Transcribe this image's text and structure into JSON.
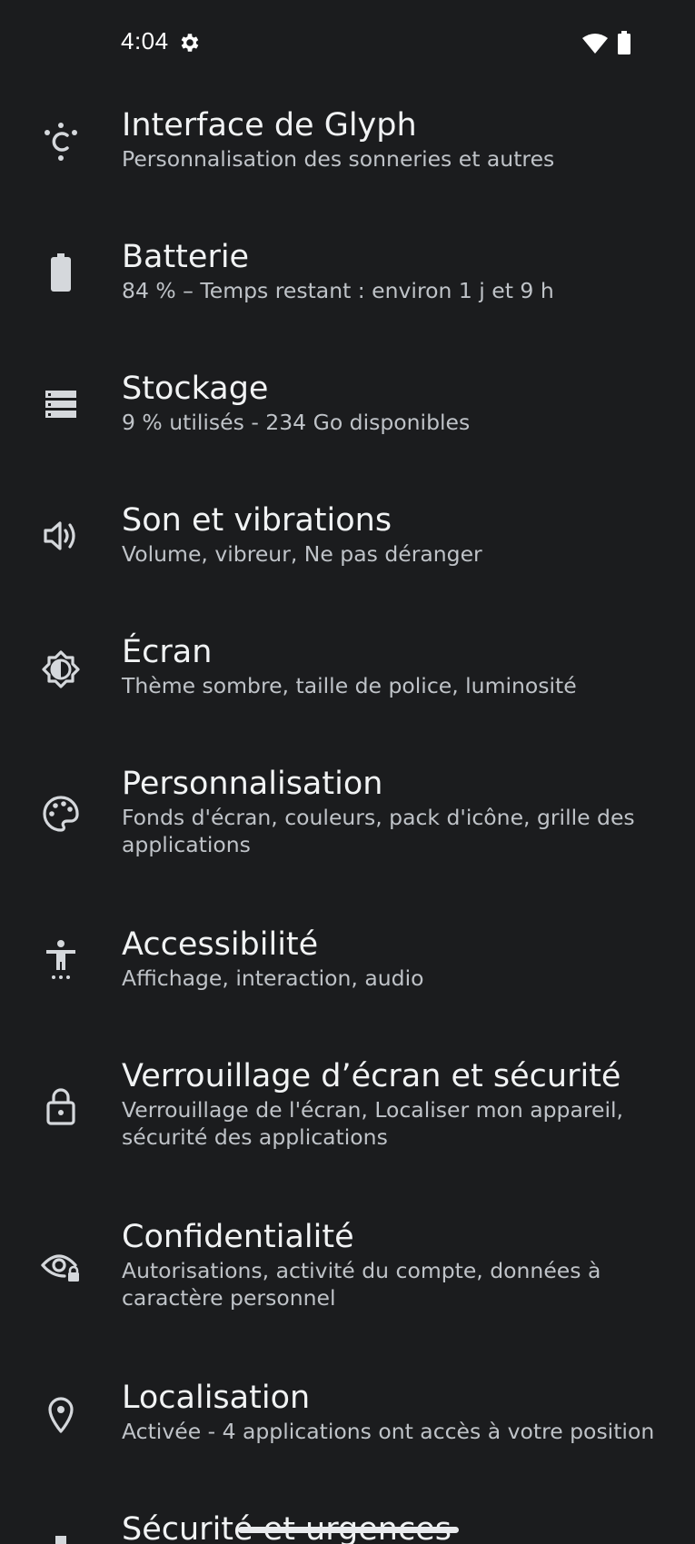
{
  "status_bar": {
    "time": "4:04",
    "icons": [
      "gear-icon",
      "wifi-icon",
      "battery-icon"
    ]
  },
  "settings": [
    {
      "title": "Interface de Glyph",
      "subtitle": "Personnalisation des sonneries et autres",
      "icon": "glyph-icon"
    },
    {
      "title": "Batterie",
      "subtitle": "84 % – Temps restant : environ 1 j et 9 h",
      "icon": "battery-icon"
    },
    {
      "title": "Stockage",
      "subtitle": "9 % utilisés - 234 Go disponibles",
      "icon": "storage-icon"
    },
    {
      "title": "Son et vibrations",
      "subtitle": "Volume, vibreur, Ne pas déranger",
      "icon": "volume-icon"
    },
    {
      "title": "Écran",
      "subtitle": "Thème sombre, taille de police, luminosité",
      "icon": "brightness-icon"
    },
    {
      "title": "Personnalisation",
      "subtitle": "Fonds d'écran, couleurs, pack d'icône, grille des applications",
      "icon": "palette-icon"
    },
    {
      "title": "Accessibilité",
      "subtitle": "Affichage, interaction, audio",
      "icon": "accessibility-icon"
    },
    {
      "title": "Verrouillage d’écran et sécurité",
      "subtitle": "Verrouillage de l'écran, Localiser mon appareil, sécurité des applications",
      "icon": "lock-icon"
    },
    {
      "title": "Confidentialité",
      "subtitle": "Autorisations, activité du compte, données à caractère personnel",
      "icon": "privacy-eye-icon"
    },
    {
      "title": "Localisation",
      "subtitle": "Activée - 4 applications ont accès à votre position",
      "icon": "location-pin-icon"
    },
    {
      "title": "Sécurité et urgences",
      "subtitle": "",
      "icon": "emergency-icon"
    }
  ],
  "colors": {
    "background": "#1b1c1e",
    "title": "#f1f3f4",
    "subtitle": "#bfc3c8",
    "icon": "#d5d8dc"
  }
}
